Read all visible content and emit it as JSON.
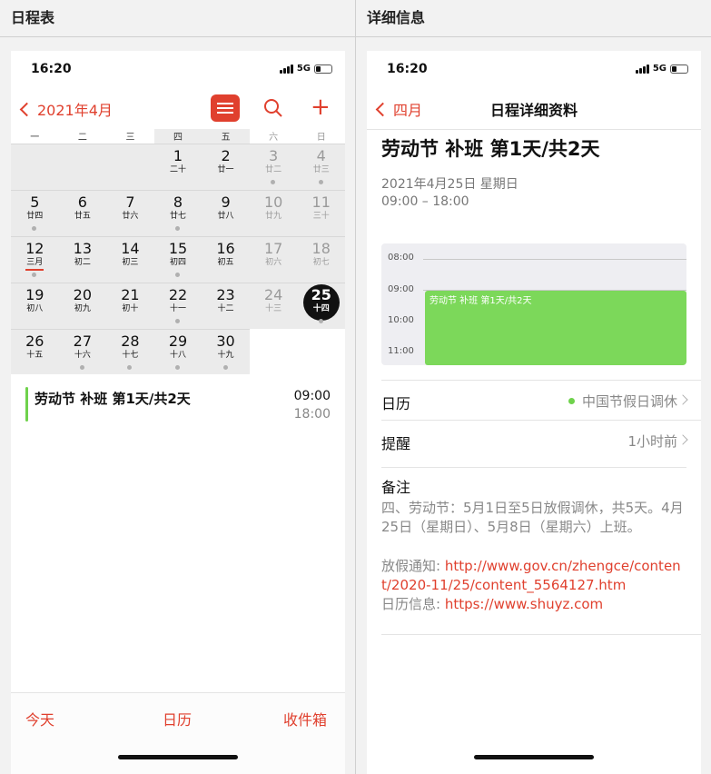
{
  "left_pane": {
    "header": "日程表",
    "status": {
      "time": "16:20",
      "network": "5G"
    },
    "nav": {
      "back_label": "2021年4月"
    },
    "weekdays": [
      "一",
      "二",
      "三",
      "四",
      "五",
      "六",
      "日"
    ],
    "days": [
      {
        "d": "1",
        "l": "二十"
      },
      {
        "d": "2",
        "l": "廿一"
      },
      {
        "d": "3",
        "l": "廿二"
      },
      {
        "d": "4",
        "l": "廿三"
      },
      {
        "d": "5",
        "l": "廿四"
      },
      {
        "d": "6",
        "l": "廿五"
      },
      {
        "d": "7",
        "l": "廿六"
      },
      {
        "d": "8",
        "l": "廿七"
      },
      {
        "d": "9",
        "l": "廿八"
      },
      {
        "d": "10",
        "l": "廿九"
      },
      {
        "d": "11",
        "l": "三十"
      },
      {
        "d": "12",
        "l": "三月"
      },
      {
        "d": "13",
        "l": "初二"
      },
      {
        "d": "14",
        "l": "初三"
      },
      {
        "d": "15",
        "l": "初四"
      },
      {
        "d": "16",
        "l": "初五"
      },
      {
        "d": "17",
        "l": "初六"
      },
      {
        "d": "18",
        "l": "初七"
      },
      {
        "d": "19",
        "l": "初八"
      },
      {
        "d": "20",
        "l": "初九"
      },
      {
        "d": "21",
        "l": "初十"
      },
      {
        "d": "22",
        "l": "十一"
      },
      {
        "d": "23",
        "l": "十二"
      },
      {
        "d": "24",
        "l": "十三"
      },
      {
        "d": "25",
        "l": "十四"
      },
      {
        "d": "26",
        "l": "十五"
      },
      {
        "d": "27",
        "l": "十六"
      },
      {
        "d": "28",
        "l": "十七"
      },
      {
        "d": "29",
        "l": "十八"
      },
      {
        "d": "30",
        "l": "十九"
      }
    ],
    "event": {
      "title": "劳动节 补班 第1天/共2天",
      "start": "09:00",
      "end": "18:00"
    },
    "tabs": {
      "today": "今天",
      "calendars": "日历",
      "inbox": "收件箱"
    }
  },
  "right_pane": {
    "header": "详细信息",
    "status": {
      "time": "16:20",
      "network": "5G"
    },
    "nav": {
      "back_label": "四月",
      "title": "日程详细资料"
    },
    "event_title": "劳动节 补班 第1天/共2天",
    "date_line": "2021年4月25日 星期日",
    "time_line": "09:00 – 18:00",
    "timeline": {
      "labels": [
        "08:00",
        "09:00",
        "10:00",
        "11:00"
      ],
      "event_label": "劳动节 补班 第1天/共2天"
    },
    "calendar_row": {
      "label": "日历",
      "value": "中国节假日调休"
    },
    "alert_row": {
      "label": "提醒",
      "value": "1小时前"
    },
    "notes": {
      "label": "备注",
      "text": "四、劳动节：5月1日至5日放假调休，共5天。4月25日（星期日）、5月8日（星期六）上班。",
      "notice_prefix": "放假通知: ",
      "notice_link": "http://www.gov.cn/zhengce/content/2020-11/25/content_5564127.htm",
      "info_prefix": "日历信息: ",
      "info_link": "https://www.shuyz.com"
    }
  },
  "colors": {
    "accent": "#e0402e",
    "event": "#7cd85a"
  }
}
